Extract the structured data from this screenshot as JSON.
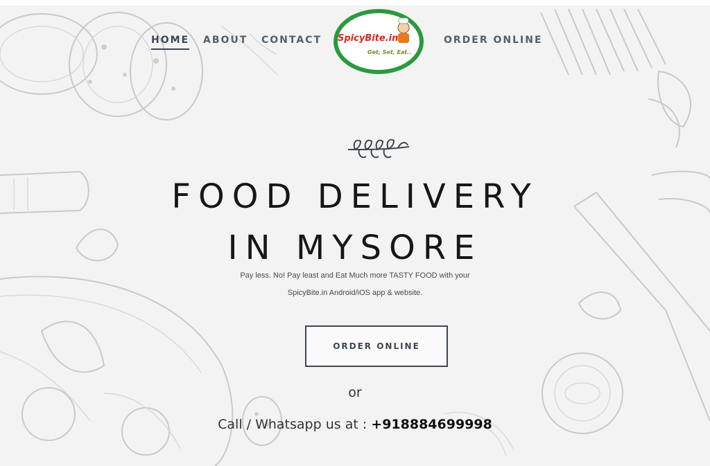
{
  "nav": {
    "items": [
      {
        "label": "HOME",
        "active": true
      },
      {
        "label": "ABOUT",
        "active": false
      },
      {
        "label": "CONTACT",
        "active": false
      },
      {
        "label": "ORDER ONLINE",
        "active": false
      }
    ]
  },
  "logo": {
    "name": "SpicyBite.in",
    "tagline": "Get, Set, Eat..",
    "ring_color": "#2a9a3c",
    "text_color": "#d42a1f",
    "icon": "chef-icon"
  },
  "hero": {
    "decor_icon": "leaf-sprig-icon",
    "title_line1": "FOOD DELIVERY",
    "title_line2": "IN MYSORE",
    "subtitle_line1": "Pay less. No! Pay least and Eat Much more TASTY FOOD with your",
    "subtitle_line2": "SpicyBite.in Android/iOS app & website.",
    "cta_label": "ORDER ONLINE",
    "or_text": "or",
    "contact_prefix": "Call / Whatsapp us at : ",
    "phone": "+918884699998"
  },
  "colors": {
    "background": "#f3f3f3",
    "nav_text": "#55606a",
    "button_border": "#3d4750",
    "sketch_lines": "#c9c9c9"
  }
}
